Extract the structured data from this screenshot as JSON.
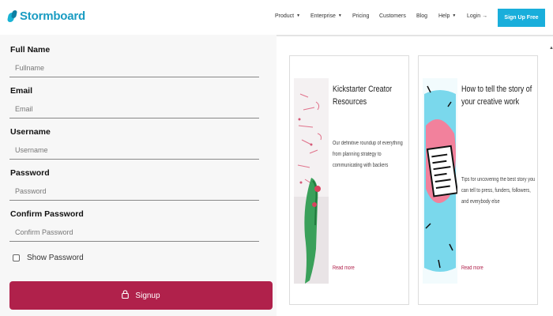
{
  "brand": {
    "name": "Stormboard"
  },
  "nav": {
    "items": [
      {
        "label": "Product",
        "dropdown": true
      },
      {
        "label": "Enterprise",
        "dropdown": true
      },
      {
        "label": "Pricing",
        "dropdown": false
      },
      {
        "label": "Customers",
        "dropdown": false
      },
      {
        "label": "Blog",
        "dropdown": false
      },
      {
        "label": "Help",
        "dropdown": true
      },
      {
        "label": "Login →",
        "dropdown": false
      }
    ],
    "cta": "Sign Up Free"
  },
  "form": {
    "fields": [
      {
        "label": "Full Name",
        "placeholder": "Fullname",
        "value": ""
      },
      {
        "label": "Email",
        "placeholder": "Email",
        "value": ""
      },
      {
        "label": "Username",
        "placeholder": "Username",
        "value": ""
      },
      {
        "label": "Password",
        "placeholder": "Password",
        "value": ""
      },
      {
        "label": "Confirm Password",
        "placeholder": "Confirm Password",
        "value": ""
      }
    ],
    "show_password": {
      "label": "Show Password",
      "checked": false
    },
    "submit": "Signup"
  },
  "cards": [
    {
      "title": "Kickstarter Creator Resources",
      "description": "Our definitive roundup of everything from planning strategy to communicating with backers",
      "link": "Read more"
    },
    {
      "title": "How to tell the story of your creative work",
      "description": "Tips for uncovering the best story you can tell to press, funders, followers, and everybody else",
      "link": "Read more"
    }
  ],
  "colors": {
    "brand": "#1a9cc2",
    "cta": "#19aedb",
    "signup": "#b0214b"
  }
}
